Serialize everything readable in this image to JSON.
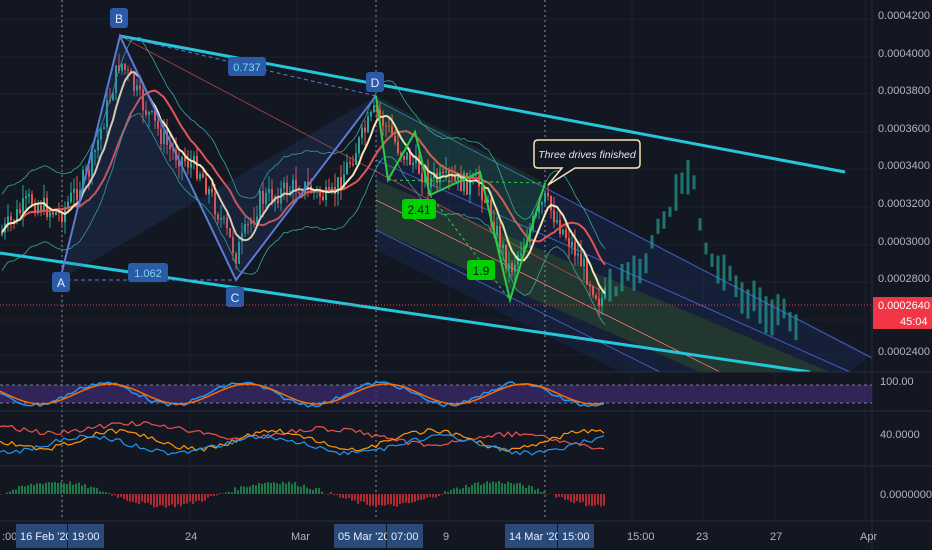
{
  "chart_data": {
    "type": "candlestick",
    "instrument_timeframe_labels": [
      "45:04"
    ],
    "price_axis": {
      "ticks": [
        "0.0004200",
        "0.0004000",
        "0.0003800",
        "0.0003600",
        "0.0003400",
        "0.0003200",
        "0.0003000",
        "0.0002800",
        "0.0002400"
      ],
      "ylim": [
        0.000228,
        0.00042
      ],
      "current_price": "0.0002640",
      "countdown": "45:04"
    },
    "time_axis": {
      "ticks": [
        ":00",
        "24",
        "Mar",
        "9",
        "15:00",
        "23",
        "27",
        "Apr"
      ],
      "highlight_labels": [
        "16 Feb '20",
        "19:00",
        "05 Mar '20",
        "07:00",
        "14 Mar '20",
        "15:00"
      ]
    },
    "pattern_points": [
      {
        "label": "A",
        "value": 0.00029
      },
      {
        "label": "B",
        "value": 0.00041
      },
      {
        "label": "C",
        "value": 0.000276
      },
      {
        "label": "D",
        "value": 0.000374
      }
    ],
    "ratio_labels": [
      "0.737",
      "1.062",
      "2.41",
      "1.9"
    ],
    "annotation": "Three drives finished",
    "oscillator_1": {
      "tick": "100.00"
    },
    "oscillator_2": {
      "tick": "40.0000"
    },
    "oscillator_3": {
      "tick": "0.0000000"
    },
    "colors": {
      "background": "#131722",
      "up": "#26a69a",
      "down": "#ef5350",
      "channel": "#26c6da",
      "pattern": "#5b7bd5",
      "harmonic": "#2ecc40",
      "price_label": "#f23645"
    }
  }
}
